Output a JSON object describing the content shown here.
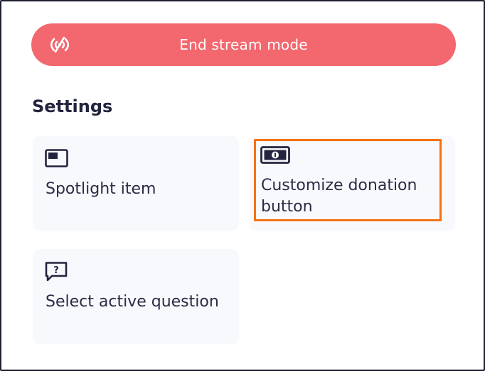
{
  "stream": {
    "end_button_label": "End stream mode",
    "end_button_icon": "broadcast-off-icon",
    "accent_color": "#f2686e"
  },
  "settings": {
    "title": "Settings",
    "cards": [
      {
        "label": "Spotlight item",
        "icon": "spotlight-window-icon"
      },
      {
        "label": "Customize donation button",
        "icon": "banknote-icon"
      },
      {
        "label": "Select active question",
        "icon": "question-bubble-icon"
      }
    ],
    "highlight_color": "#f47211"
  }
}
